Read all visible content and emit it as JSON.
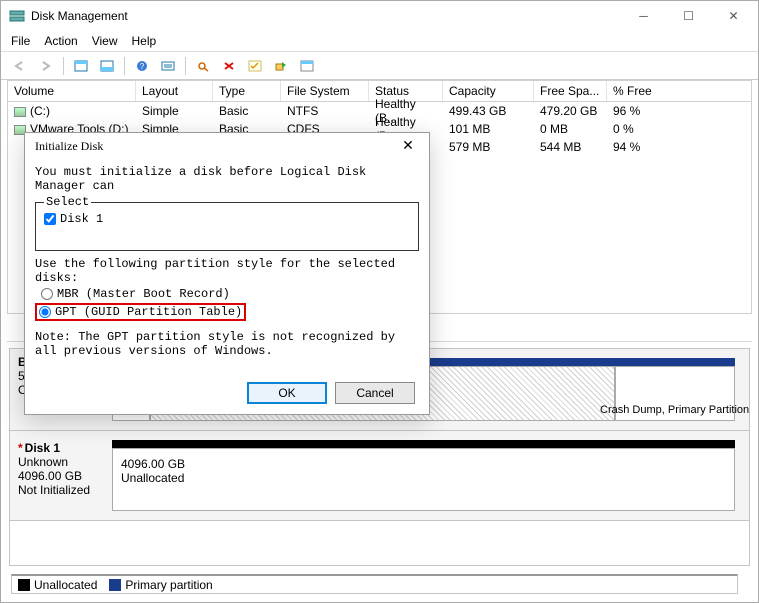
{
  "window": {
    "title": "Disk Management",
    "menus": [
      "File",
      "Action",
      "View",
      "Help"
    ]
  },
  "columns": {
    "volume": "Volume",
    "layout": "Layout",
    "type": "Type",
    "fs": "File System",
    "status": "Status",
    "capacity": "Capacity",
    "free": "Free Spa...",
    "pct": "% Free"
  },
  "volumes": [
    {
      "name": "(C:)",
      "layout": "Simple",
      "type": "Basic",
      "fs": "NTFS",
      "status": "Healthy (B...",
      "capacity": "499.43 GB",
      "free": "479.20 GB",
      "pct": "96 %"
    },
    {
      "name": "VMware Tools (D:)",
      "layout": "Simple",
      "type": "Basic",
      "fs": "CDFS",
      "status": "Healthy (P...",
      "capacity": "101 MB",
      "free": "0 MB",
      "pct": "0 %"
    },
    {
      "name": "",
      "layout": "",
      "type": "",
      "fs": "",
      "status": "",
      "capacity": "579 MB",
      "free": "544 MB",
      "pct": "94 %"
    }
  ],
  "graphical": {
    "disk0": {
      "name": "Ba",
      "size_line": "50",
      "status_line": "O",
      "region_hint": "Crash Dump, Primary Partition)"
    },
    "disk1": {
      "name": "Disk 1",
      "type": "Unknown",
      "size": "4096.00 GB",
      "status": "Not Initialized",
      "region_size": "4096.00 GB",
      "region_state": "Unallocated"
    }
  },
  "legend": {
    "unallocated": "Unallocated",
    "primary": "Primary partition"
  },
  "dialog": {
    "title": "Initialize Disk",
    "message": "You must initialize a disk before Logical Disk Manager can",
    "select_label": "Select",
    "disk_item": "Disk 1",
    "disk_checked": true,
    "style_label": "Use the following partition style for the selected disks:",
    "radio_mbr": "MBR (Master Boot Record)",
    "radio_gpt": "GPT (GUID Partition Table)",
    "selected_style": "gpt",
    "note": "Note: The GPT partition style is not recognized by all previous versions of Windows.",
    "ok": "OK",
    "cancel": "Cancel"
  }
}
